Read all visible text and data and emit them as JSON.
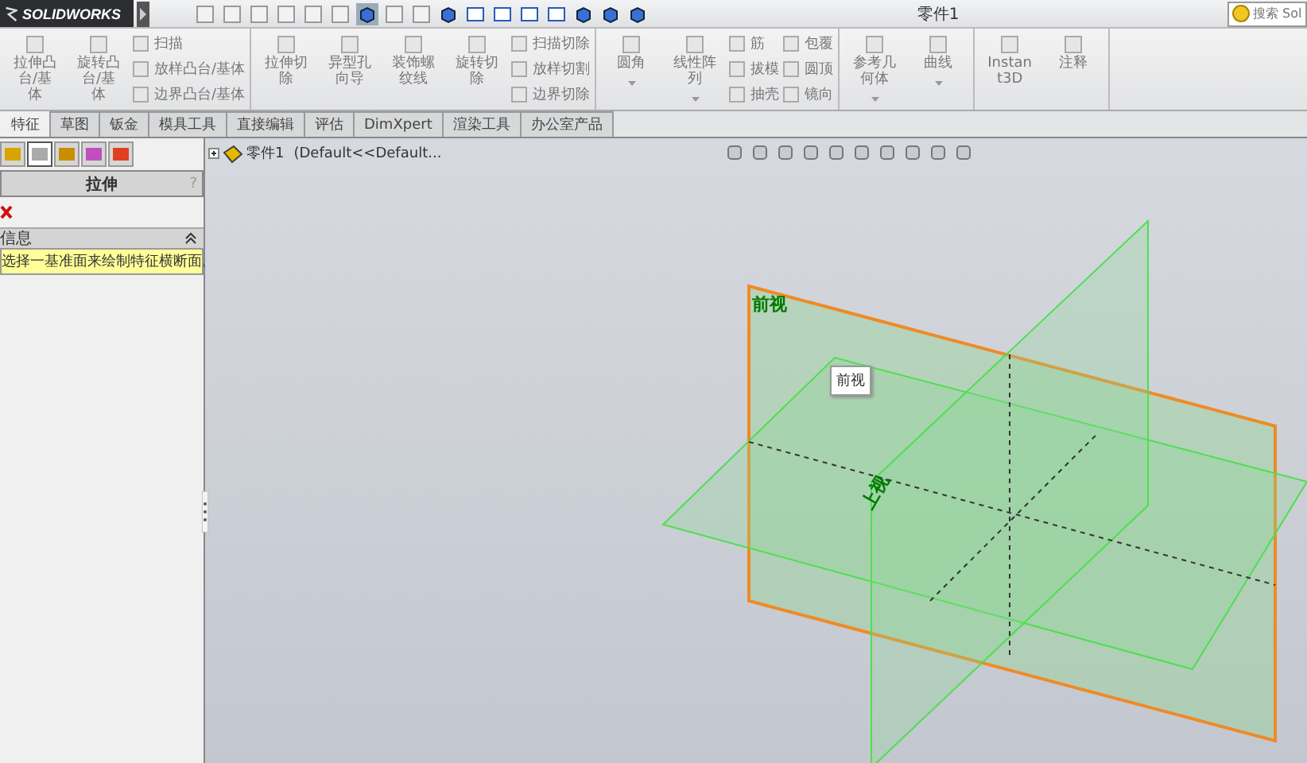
{
  "app": {
    "logo": "SOLIDWORKS",
    "title": "零件1",
    "search": {
      "placeholder": "搜索 Sol"
    }
  },
  "ribbon": {
    "groups": [
      {
        "large": [
          {
            "label": "拉伸凸台/基体"
          },
          {
            "label": "旋转凸台/基体"
          }
        ],
        "small": [
          [
            "扫描",
            "放样凸台/基体",
            "边界凸台/基体"
          ]
        ]
      },
      {
        "large": [
          {
            "label": "拉伸切除"
          },
          {
            "label": "异型孔向导"
          },
          {
            "label": "装饰螺纹线"
          },
          {
            "label": "旋转切除"
          }
        ],
        "small": [
          [
            "扫描切除",
            "放样切割",
            "边界切除"
          ]
        ]
      },
      {
        "large": [
          {
            "label": "圆角",
            "dropdown": true
          },
          {
            "label": "线性阵列",
            "dropdown": true
          }
        ],
        "small": [
          [
            "筋",
            "拔模",
            "抽壳"
          ],
          [
            "包覆",
            "圆顶",
            "镜向"
          ]
        ]
      },
      {
        "large": [
          {
            "label": "参考几何体",
            "dropdown": true
          },
          {
            "label": "曲线",
            "dropdown": true
          }
        ]
      },
      {
        "large": [
          {
            "label": "Instant3D"
          },
          {
            "label": "注释"
          }
        ]
      }
    ]
  },
  "tabs": [
    {
      "label": "特征",
      "selected": true
    },
    {
      "label": "草图",
      "selected": false
    },
    {
      "label": "钣金",
      "selected": false
    },
    {
      "label": "模具工具",
      "selected": false
    },
    {
      "label": "直接编辑",
      "selected": false
    },
    {
      "label": "评估",
      "selected": false
    },
    {
      "label": "DimXpert",
      "selected": false
    },
    {
      "label": "渲染工具",
      "selected": false
    },
    {
      "label": "办公室产品",
      "selected": false
    }
  ],
  "panel": {
    "icon_tabs": [
      {
        "selected": false
      },
      {
        "selected": true
      },
      {
        "selected": false
      },
      {
        "selected": false
      },
      {
        "selected": false
      }
    ],
    "title": "拉伸",
    "help": "?",
    "section": {
      "title": "信息",
      "expanded": true,
      "message": "选择一基准面来绘制特征横断面。"
    }
  },
  "tree": {
    "root": "零件1",
    "config": "(Default<<Default..."
  },
  "planes": [
    {
      "label": "前视",
      "selected": true
    },
    {
      "label": "上视",
      "selected": false
    },
    {
      "selected": false
    }
  ],
  "tooltip": "前视"
}
